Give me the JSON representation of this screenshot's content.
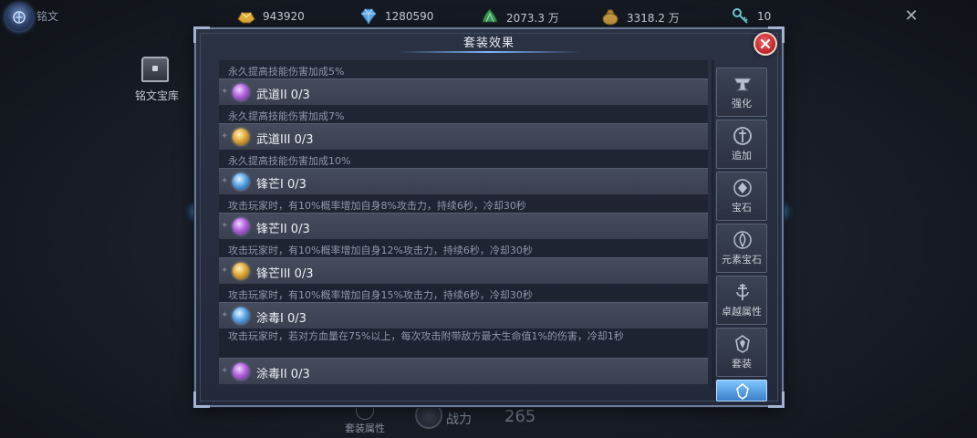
{
  "header": {
    "title": "铭文",
    "close_symbol": "✕"
  },
  "resources": [
    {
      "icon": "gold-ingot-icon",
      "value": "943920"
    },
    {
      "icon": "diamond-icon",
      "value": "1280590"
    },
    {
      "icon": "jade-icon",
      "value": "2073.3 万"
    },
    {
      "icon": "coin-bag-icon",
      "value": "3318.2 万"
    },
    {
      "icon": "key-icon",
      "value": "10"
    }
  ],
  "sidebar": {
    "vault_label": "铭文宝库"
  },
  "bottom": {
    "set_label": "套装属性",
    "power_label": "战力",
    "power_value": "265"
  },
  "panel": {
    "title": "套装效果",
    "rows": [
      {
        "kind": "desc",
        "text": "永久提高技能伤害加成5%"
      },
      {
        "kind": "item",
        "gem": "purple",
        "name": "武道II 0/3"
      },
      {
        "kind": "desc",
        "text": "永久提高技能伤害加成7%"
      },
      {
        "kind": "item",
        "gem": "gold",
        "name": "武道III 0/3"
      },
      {
        "kind": "desc",
        "text": "永久提高技能伤害加成10%"
      },
      {
        "kind": "item",
        "gem": "blue",
        "name": "锋芒I 0/3"
      },
      {
        "kind": "desc",
        "text": "攻击玩家时，有10%概率增加自身8%攻击力，持续6秒，冷却30秒"
      },
      {
        "kind": "item",
        "gem": "purple",
        "name": "锋芒II 0/3"
      },
      {
        "kind": "desc",
        "text": "攻击玩家时，有10%概率增加自身12%攻击力，持续6秒，冷却30秒"
      },
      {
        "kind": "item",
        "gem": "gold",
        "name": "锋芒III 0/3"
      },
      {
        "kind": "desc",
        "text": "攻击玩家时，有10%概率增加自身15%攻击力，持续6秒，冷却30秒"
      },
      {
        "kind": "item",
        "gem": "blue",
        "name": "涂毒I 0/3"
      },
      {
        "kind": "desc",
        "tall": true,
        "text": "攻击玩家时，若对方血量在75%以上，每次攻击附带敌方最大生命值1%的伤害，冷却1秒"
      },
      {
        "kind": "item",
        "gem": "purple",
        "name": "涂毒II 0/3"
      }
    ],
    "tabs": [
      {
        "label": "强化",
        "icon": "anvil-icon"
      },
      {
        "label": "追加",
        "icon": "sword-circle-icon"
      },
      {
        "label": "宝石",
        "icon": "gem-slot-icon"
      },
      {
        "label": "元素宝石",
        "icon": "element-gem-icon"
      },
      {
        "label": "卓越属性",
        "icon": "excellence-icon"
      },
      {
        "label": "套装",
        "icon": "set-emblem-icon"
      },
      {
        "label": "",
        "icon": "inscription-icon",
        "active": true
      }
    ]
  },
  "colors": {
    "gem_purple": "#b266dd",
    "gem_gold": "#e0a93a",
    "gem_blue": "#5aa6e8",
    "close_red": "#c62b31",
    "active_tab": "#7fc6ff"
  }
}
